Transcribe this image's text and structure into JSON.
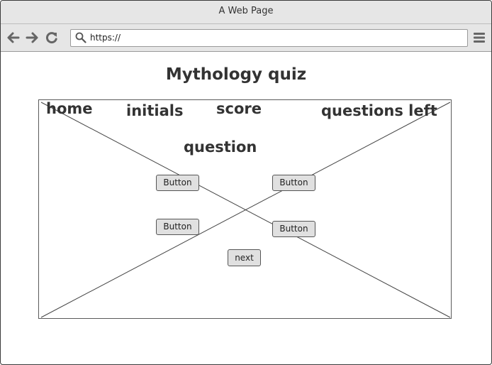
{
  "window": {
    "title": "A Web Page"
  },
  "browser": {
    "url": "https://"
  },
  "page": {
    "title": "Mythology quiz",
    "nav": {
      "home": "home",
      "initials": "initials",
      "score": "score",
      "questions_left": "questions left"
    },
    "question": "question",
    "answers": [
      "Button",
      "Button",
      "Button",
      "Button"
    ],
    "next_label": "next"
  },
  "icons": {
    "back": "arrow-left-icon",
    "forward": "arrow-right-icon",
    "reload": "reload-icon",
    "search": "search-icon",
    "menu": "hamburger-menu-icon"
  }
}
